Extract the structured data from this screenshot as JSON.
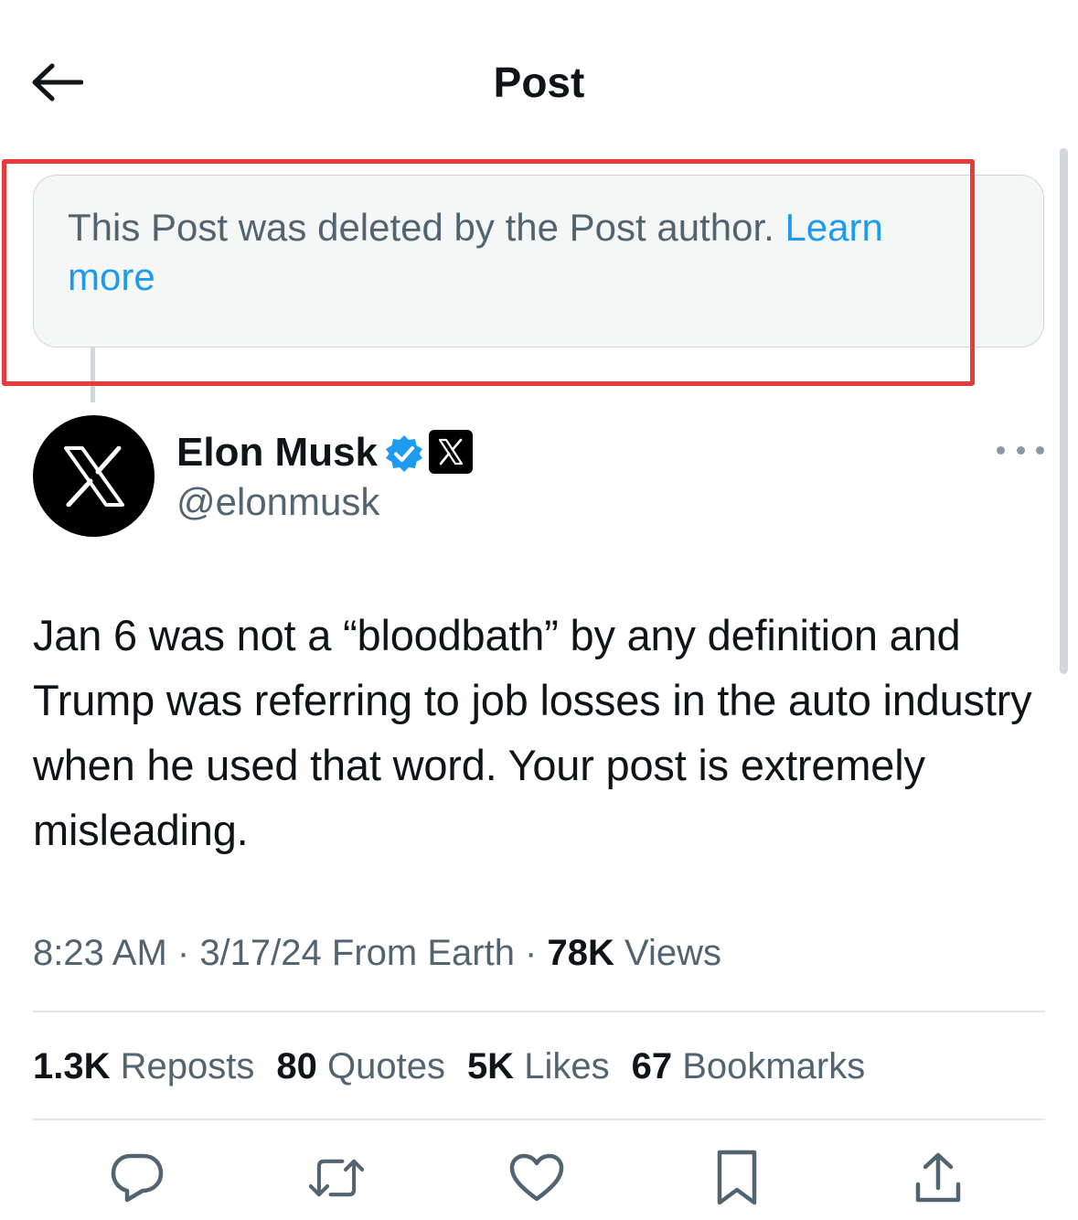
{
  "header": {
    "title": "Post"
  },
  "deleted_notice": {
    "text": "This Post was deleted by the Post author. ",
    "link": "Learn more"
  },
  "author": {
    "name": "Elon Musk",
    "handle": "@elonmusk"
  },
  "post": {
    "text": "Jan 6 was not a “bloodbath” by any definition and Trump was referring to job losses in the auto industry when he used that word. Your post is extremely misleading."
  },
  "meta": {
    "time": "8:23 AM",
    "sep1": " · ",
    "date": "3/17/24",
    "location": " From Earth",
    "sep2": " · ",
    "views_count": "78K",
    "views_label": " Views"
  },
  "stats": [
    {
      "count": "1.3K",
      "label": " Reposts"
    },
    {
      "count": "80",
      "label": " Quotes"
    },
    {
      "count": "5K",
      "label": " Likes"
    },
    {
      "count": "67",
      "label": " Bookmarks"
    }
  ],
  "actions": [
    "reply-icon",
    "repost-icon",
    "like-icon",
    "bookmark-icon",
    "share-icon"
  ],
  "colors": {
    "link": "#1d9bf0",
    "secondary_text": "#536471",
    "highlight_border": "#ea3b3b",
    "verified": "#1d9bf0"
  }
}
